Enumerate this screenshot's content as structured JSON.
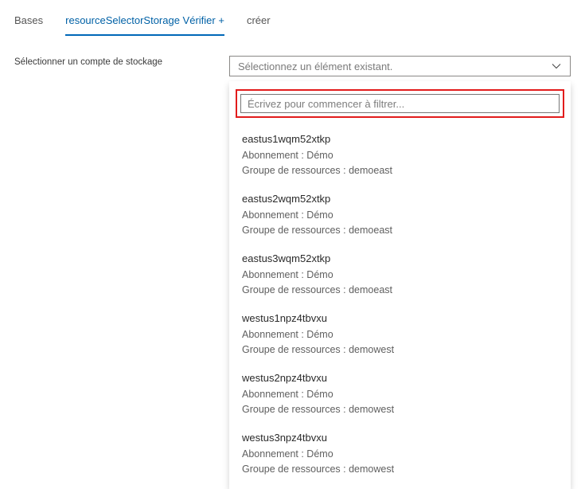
{
  "tabs": {
    "t1": "Bases",
    "t2": "resourceSelectorStorage Vérifier +",
    "t3": "créer"
  },
  "form": {
    "storage_label": "Sélectionner un compte de stockage"
  },
  "select": {
    "placeholder": "Sélectionnez un élément existant.",
    "filter_placeholder": "Écrivez pour commencer à filtrer..."
  },
  "labels": {
    "subscription_prefix": "Abonnement : ",
    "rg_prefix": "Groupe de ressources : "
  },
  "options": [
    {
      "name": "eastus1wqm52xtkp",
      "sub": "Démo",
      "rg": "demoeast"
    },
    {
      "name": "eastus2wqm52xtkp",
      "sub": "Démo",
      "rg": "demoeast"
    },
    {
      "name": "eastus3wqm52xtkp",
      "sub": "Démo",
      "rg": "demoeast"
    },
    {
      "name": "westus1npz4tbvxu",
      "sub": "Démo",
      "rg": "demowest"
    },
    {
      "name": "westus2npz4tbvxu",
      "sub": "Démo",
      "rg": "demowest"
    },
    {
      "name": "westus3npz4tbvxu",
      "sub": "Démo",
      "rg": "demowest"
    }
  ]
}
